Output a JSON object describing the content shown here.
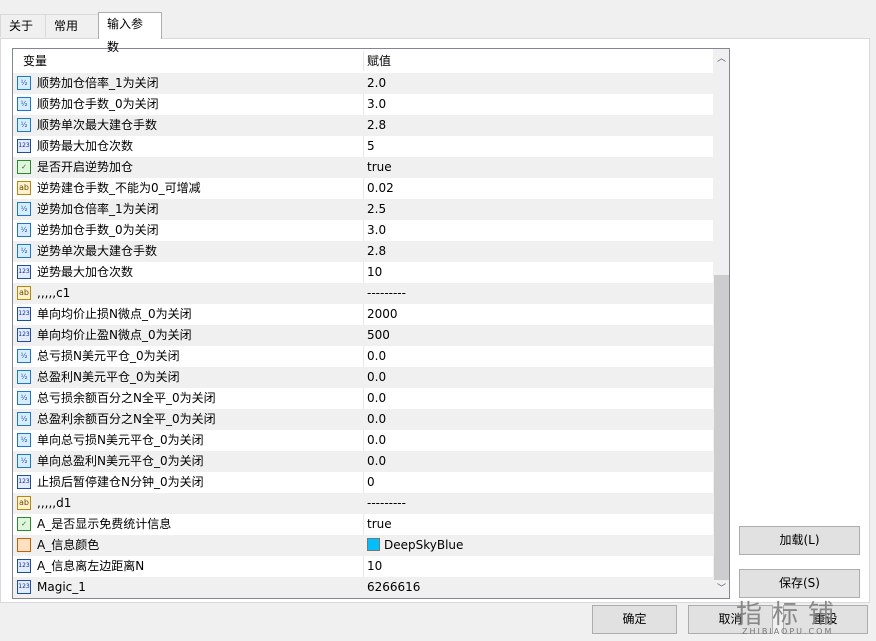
{
  "tabs": [
    {
      "label": "关于"
    },
    {
      "label": "常用"
    },
    {
      "label": "输入参数"
    }
  ],
  "grid": {
    "col_variable": "变量",
    "col_value": "赋值",
    "rows": [
      {
        "icon": "double",
        "name": "顺势加仓倍率_1为关闭",
        "value": "2.0"
      },
      {
        "icon": "double",
        "name": "顺势加仓手数_0为关闭",
        "value": "3.0"
      },
      {
        "icon": "double",
        "name": "顺势单次最大建仓手数",
        "value": "2.8"
      },
      {
        "icon": "int",
        "name": "顺势最大加仓次数",
        "value": "5"
      },
      {
        "icon": "bool",
        "name": "是否开启逆势加仓",
        "value": "true"
      },
      {
        "icon": "string",
        "name": "逆势建仓手数_不能为0_可增减",
        "value": "0.02"
      },
      {
        "icon": "double",
        "name": "逆势加仓倍率_1为关闭",
        "value": "2.5"
      },
      {
        "icon": "double",
        "name": "逆势加仓手数_0为关闭",
        "value": "3.0"
      },
      {
        "icon": "double",
        "name": "逆势单次最大建仓手数",
        "value": "2.8"
      },
      {
        "icon": "int",
        "name": "逆势最大加仓次数",
        "value": "10"
      },
      {
        "icon": "string",
        "name": ",,,,,c1",
        "value": "---------"
      },
      {
        "icon": "int",
        "name": "单向均价止损N微点_0为关闭",
        "value": "2000"
      },
      {
        "icon": "int",
        "name": "单向均价止盈N微点_0为关闭",
        "value": "500"
      },
      {
        "icon": "double",
        "name": "总亏损N美元平仓_0为关闭",
        "value": "0.0"
      },
      {
        "icon": "double",
        "name": "总盈利N美元平仓_0为关闭",
        "value": "0.0"
      },
      {
        "icon": "double",
        "name": "总亏损余额百分之N全平_0为关闭",
        "value": "0.0"
      },
      {
        "icon": "double",
        "name": "总盈利余额百分之N全平_0为关闭",
        "value": "0.0"
      },
      {
        "icon": "double",
        "name": "单向总亏损N美元平仓_0为关闭",
        "value": "0.0"
      },
      {
        "icon": "double",
        "name": "单向总盈利N美元平仓_0为关闭",
        "value": "0.0"
      },
      {
        "icon": "int",
        "name": "止损后暂停建仓N分钟_0为关闭",
        "value": "0"
      },
      {
        "icon": "string",
        "name": ",,,,,d1",
        "value": "---------"
      },
      {
        "icon": "bool",
        "name": "A_是否显示免费统计信息",
        "value": "true"
      },
      {
        "icon": "color",
        "name": "A_信息颜色",
        "value": "DeepSkyBlue",
        "swatch": "#00bfff"
      },
      {
        "icon": "int",
        "name": "A_信息离左边距离N",
        "value": "10"
      },
      {
        "icon": "int",
        "name": "Magic_1",
        "value": "6266616"
      }
    ]
  },
  "icons": {
    "double": "½",
    "int": "123",
    "bool": "✓",
    "string": "ab",
    "color": ""
  },
  "buttons": {
    "load": "加载(L)",
    "save": "保存(S)",
    "ok": "确定",
    "cancel": "取消",
    "reset": "重设"
  },
  "watermark": {
    "main": "指标铺",
    "sub": "ZHIBIAOPU.COM"
  }
}
